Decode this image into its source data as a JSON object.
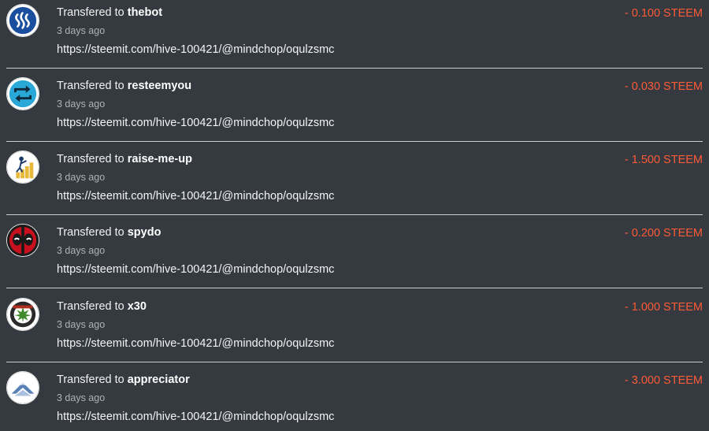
{
  "transfers": [
    {
      "avatar_icon": "steem-logo-icon",
      "prefix": "Transfered to ",
      "recipient": "thebot",
      "time": "3 days ago",
      "memo": "https://steemit.com/hive-100421/@mindchop/oqulzsmc",
      "amount": "- 0.100 STEEM"
    },
    {
      "avatar_icon": "resteem-arrows-icon",
      "prefix": "Transfered to ",
      "recipient": "resteemyou",
      "time": "3 days ago",
      "memo": "https://steemit.com/hive-100421/@mindchop/oqulzsmc",
      "amount": "- 0.030 STEEM"
    },
    {
      "avatar_icon": "rising-chart-icon",
      "prefix": "Transfered to ",
      "recipient": "raise-me-up",
      "time": "3 days ago",
      "memo": "https://steemit.com/hive-100421/@mindchop/oqulzsmc",
      "amount": "- 1.500 STEEM"
    },
    {
      "avatar_icon": "deadpool-mask-icon",
      "prefix": "Transfered to ",
      "recipient": "spydo",
      "time": "3 days ago",
      "memo": "https://steemit.com/hive-100421/@mindchop/oqulzsmc",
      "amount": "- 0.200 STEEM"
    },
    {
      "avatar_icon": "leaf-emblem-icon",
      "prefix": "Transfered to ",
      "recipient": "x30",
      "time": "3 days ago",
      "memo": "https://steemit.com/hive-100421/@mindchop/oqulzsmc",
      "amount": "- 1.000 STEEM"
    },
    {
      "avatar_icon": "mountain-logo-icon",
      "prefix": "Transfered to ",
      "recipient": "appreciator",
      "time": "3 days ago",
      "memo": "https://steemit.com/hive-100421/@mindchop/oqulzsmc",
      "amount": "- 3.000 STEEM"
    }
  ],
  "colors": {
    "background": "#343a40",
    "amount": "#ff5a36",
    "divider": "#c9cdd1",
    "timestamp": "#aeb3b8"
  }
}
